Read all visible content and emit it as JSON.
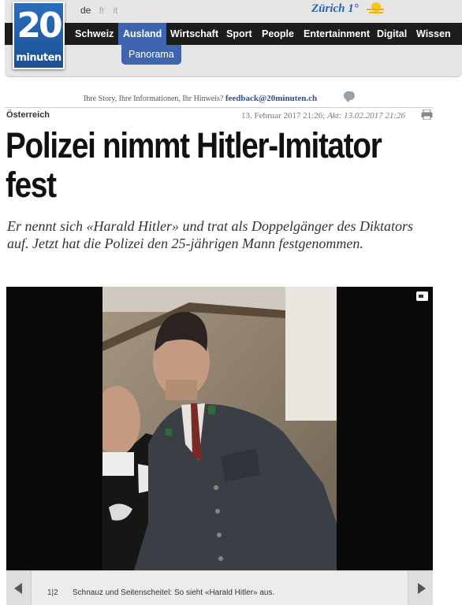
{
  "brand": {
    "logo_number": "20",
    "logo_word": "minuten"
  },
  "languages": [
    {
      "code": "de",
      "active": true
    },
    {
      "code": "fr",
      "active": false
    },
    {
      "code": "it",
      "active": false
    }
  ],
  "weather": {
    "city": "Zürich",
    "temperature": "1°",
    "icon": "sun-cloud-icon"
  },
  "nav": {
    "items": [
      "Schweiz",
      "Ausland",
      "Wirtschaft",
      "Sport",
      "People",
      "Entertainment",
      "Digital",
      "Wissen"
    ],
    "active": "Ausland",
    "sub_item": "Panorama"
  },
  "feedback": {
    "text": "Ihre Story, Ihre Informationen, Ihr Hinweis?",
    "email": "feedback@20minuten.ch"
  },
  "article": {
    "category": "Österreich",
    "date": "13. Februar 2017 21:26;",
    "updated": "Akt: 13.02.2017 21:26",
    "title": "Polizei nimmt Hitler-Imitator fest",
    "lead": "Er nennt sich «Harald Hitler» und trat als Doppelgänger des Diktators auf. Jetzt hat die Polizei den 25-jährigen Mann festgenommen."
  },
  "gallery": {
    "counter": "1|2",
    "caption": "Schnauz und Seitenscheitel: So sieht «Harald Hitler» aus."
  },
  "colors": {
    "accent": "#3d65b0",
    "navbar": "#1d1d1d",
    "logo": "#1b4f95",
    "email": "#2b4f9c"
  }
}
